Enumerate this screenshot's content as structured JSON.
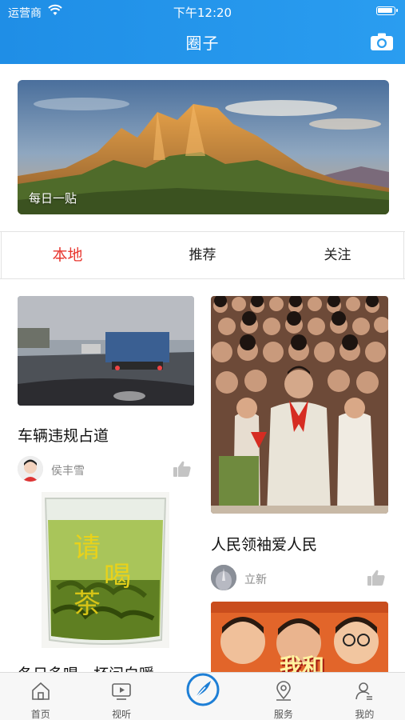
{
  "status": {
    "carrier": "运营商",
    "time": "下午12:20"
  },
  "header": {
    "title": "圈子"
  },
  "banner": {
    "caption": "每日一贴"
  },
  "tabs": [
    {
      "label": "本地",
      "active": true
    },
    {
      "label": "推荐",
      "active": false
    },
    {
      "label": "关注",
      "active": false
    }
  ],
  "feed": {
    "left": [
      {
        "title": "车辆违规占道",
        "author": "侯丰雪"
      },
      {
        "title": "冬日多喝一杯问白暖",
        "image_text": [
          "请",
          "喝",
          "茶"
        ]
      }
    ],
    "right": [
      {
        "title": "人民领袖爱人民",
        "author": "立新"
      },
      {
        "title": "我和"
      }
    ]
  },
  "tabbar": {
    "items": [
      {
        "label": "首页",
        "icon": "home-icon"
      },
      {
        "label": "视听",
        "icon": "video-icon"
      },
      {
        "label": "",
        "icon": "center-feather-icon"
      },
      {
        "label": "服务",
        "icon": "location-icon"
      },
      {
        "label": "我的",
        "icon": "user-icon"
      }
    ]
  },
  "colors": {
    "header": "#1f8ee6",
    "active_tab": "#e8372f",
    "center_icon": "#1e7fd6"
  }
}
